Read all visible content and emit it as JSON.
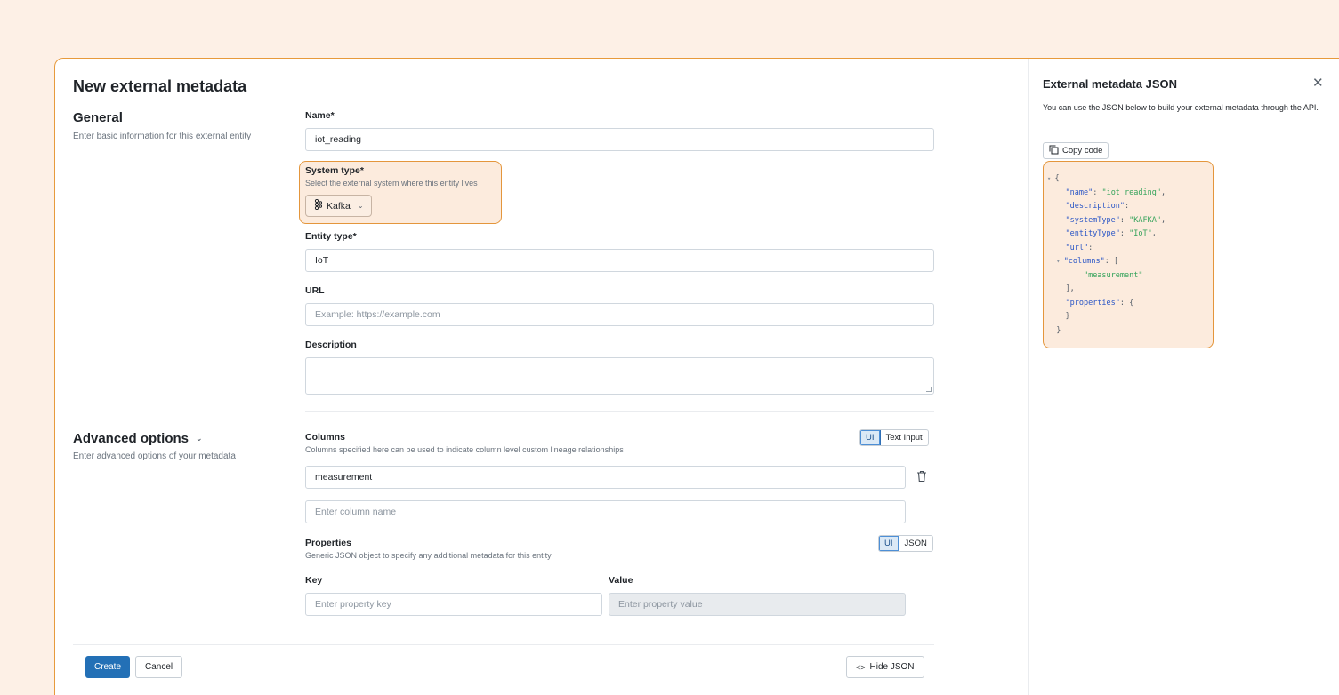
{
  "page": {
    "title": "New external metadata"
  },
  "general": {
    "title": "General",
    "subtitle": "Enter basic information for this external entity",
    "name_label": "Name*",
    "name_value": "iot_reading",
    "system_type_label": "System type*",
    "system_type_hint": "Select the external system where this entity lives",
    "system_type_value": "Kafka",
    "entity_type_label": "Entity type*",
    "entity_type_value": "IoT",
    "url_label": "URL",
    "url_placeholder": "Example: https://example.com",
    "description_label": "Description"
  },
  "advanced": {
    "title": "Advanced options",
    "subtitle": "Enter advanced options of your metadata",
    "columns_label": "Columns",
    "columns_hint": "Columns specified here can be used to indicate column level custom lineage relationships",
    "columns_toggle": [
      "UI",
      "Text Input"
    ],
    "column_value": "measurement",
    "column_placeholder": "Enter column name",
    "properties_label": "Properties",
    "properties_hint": "Generic JSON object to specify any additional metadata for this entity",
    "properties_toggle": [
      "UI",
      "JSON"
    ],
    "key_label": "Key",
    "value_label": "Value",
    "key_placeholder": "Enter property key",
    "value_placeholder": "Enter property value"
  },
  "footer": {
    "create": "Create",
    "cancel": "Cancel",
    "hide_json": "Hide JSON"
  },
  "side": {
    "title": "External metadata JSON",
    "desc": "You can use the JSON below to build your external metadata through the API.",
    "copy": "Copy code",
    "code_lines": [
      {
        "indent": 0,
        "arrow": true,
        "text": "{"
      },
      {
        "indent": 2,
        "key": "\"name\"",
        "sep": ": ",
        "val": "\"iot_reading\"",
        "tail": ","
      },
      {
        "indent": 2,
        "key": "\"description\"",
        "sep": ":",
        "val": "",
        "tail": ""
      },
      {
        "indent": 2,
        "key": "\"systemType\"",
        "sep": ": ",
        "val": "\"KAFKA\"",
        "tail": ","
      },
      {
        "indent": 2,
        "key": "\"entityType\"",
        "sep": ": ",
        "val": "\"IoT\"",
        "tail": ","
      },
      {
        "indent": 2,
        "key": "\"url\"",
        "sep": ":",
        "val": "",
        "tail": ""
      },
      {
        "indent": 1,
        "arrow": true,
        "key": "\"columns\"",
        "sep": ": ",
        "val": "",
        "tail": "["
      },
      {
        "indent": 4,
        "key": "",
        "sep": "",
        "val": "\"measurement\"",
        "tail": ""
      },
      {
        "indent": 2,
        "key": "",
        "sep": "",
        "val": "",
        "tail": "],"
      },
      {
        "indent": 2,
        "key": "\"properties\"",
        "sep": ": ",
        "val": "",
        "tail": "{"
      },
      {
        "indent": 2,
        "key": "",
        "sep": "",
        "val": "",
        "tail": "}"
      },
      {
        "indent": 1,
        "key": "",
        "sep": "",
        "val": "",
        "tail": "}"
      }
    ]
  },
  "colors": {
    "accent": "#2370b6",
    "highlight_border": "#e4963c",
    "highlight_bg": "#fcebdd",
    "page_bg": "#fdf0e6"
  }
}
